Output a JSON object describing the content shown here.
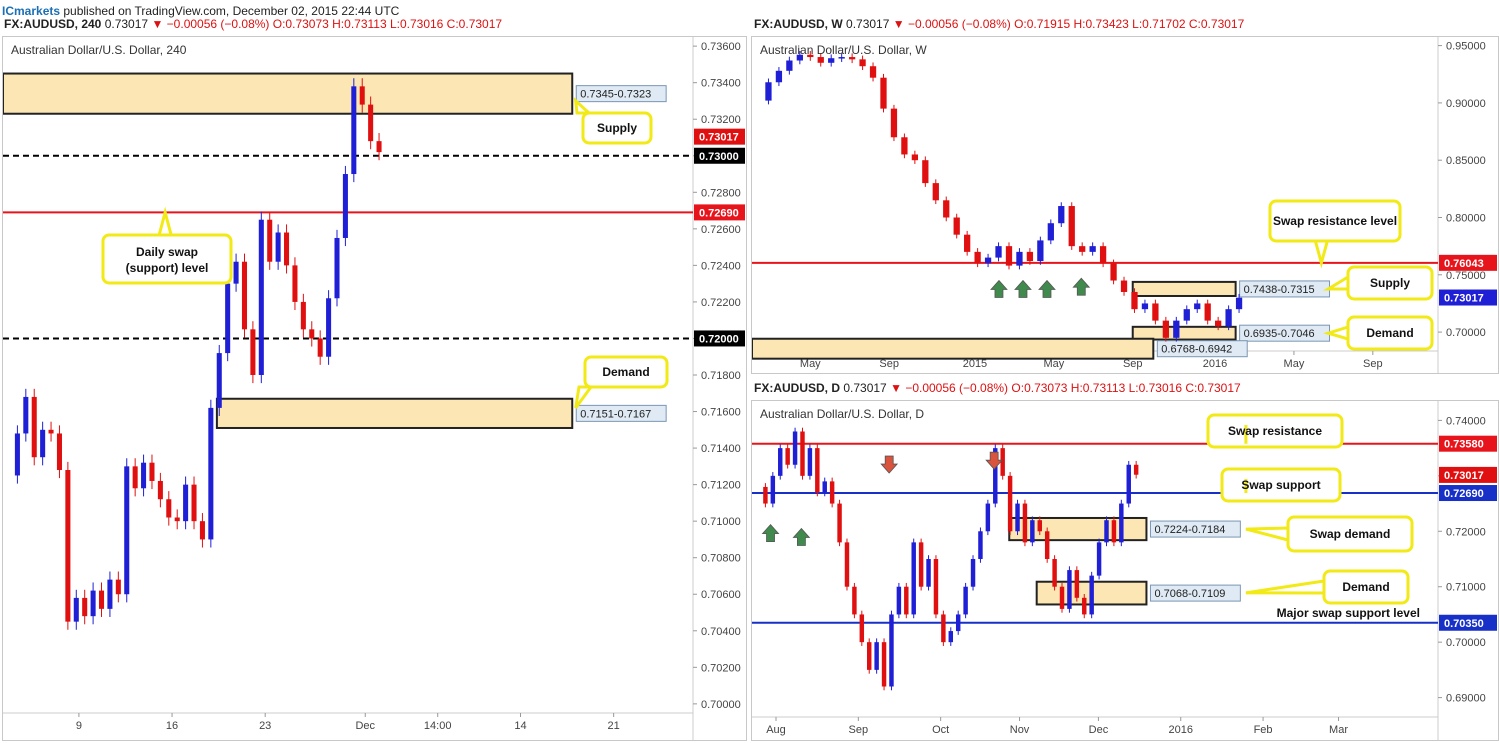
{
  "header": {
    "brand": "ICmarkets",
    "published": " published on TradingView.com, December 02, 2015 22:44 UTC"
  },
  "quote_4h": {
    "symbol": "FX:AUDUSD, 240",
    "price": "0.73017",
    "change": "−0.00056 (−0.08%)",
    "ohlc": "O:0.73073 H:0.73113 L:0.73016 C:0.73017"
  },
  "quote_w": {
    "symbol": "FX:AUDUSD, W",
    "price": "0.73017",
    "change": "−0.00056 (−0.08%)",
    "ohlc": "O:0.71915 H:0.73423 L:0.71702 C:0.73017"
  },
  "quote_d": {
    "symbol": "FX:AUDUSD, D",
    "price": "0.73017",
    "change": "−0.00056 (−0.08%)",
    "ohlc": "O:0.73073 H:0.73113 L:0.73016 C:0.73017"
  },
  "colors": {
    "up": "#1f1fd6",
    "down": "#e01010",
    "zone_fill": "#fce7b4",
    "callout_border": "#f2ea17",
    "arrow_green": "#3f8a4c",
    "arrow_red": "#d9533d",
    "hline_red": "#e8141c",
    "hline_blue": "#1730c7"
  },
  "chart_data": [
    {
      "id": "h4",
      "type": "candlestick",
      "title": "Australian Dollar/U.S. Dollar, 240",
      "ylim": [
        0.6995,
        0.7365
      ],
      "y_ticks": [
        "0.73600",
        "0.73400",
        "0.73200",
        "0.73000",
        "0.72800",
        "0.72600",
        "0.72400",
        "0.72200",
        "0.72000",
        "0.71800",
        "0.71600",
        "0.71400",
        "0.71200",
        "0.71000",
        "0.70800",
        "0.70600",
        "0.70400",
        "0.70200",
        "0.70000"
      ],
      "x_ticks": [
        "9",
        "16",
        "23",
        "Dec",
        "14:00",
        "14",
        "21"
      ],
      "x_tick_pos": [
        0.11,
        0.245,
        0.38,
        0.525,
        0.63,
        0.75,
        0.885
      ],
      "path": [
        0.7125,
        0.7148,
        0.7168,
        0.7135,
        0.715,
        0.7148,
        0.7128,
        0.7045,
        0.7058,
        0.7048,
        0.7062,
        0.7052,
        0.7068,
        0.706,
        0.713,
        0.7118,
        0.7132,
        0.7122,
        0.7112,
        0.7102,
        0.71,
        0.712,
        0.71,
        0.709,
        0.7162,
        0.7192,
        0.723,
        0.7242,
        0.7205,
        0.718,
        0.7265,
        0.7242,
        0.7258,
        0.724,
        0.722,
        0.7205,
        0.72,
        0.719,
        0.7222,
        0.7255,
        0.729,
        0.7338,
        0.7328,
        0.7308,
        0.7302
      ],
      "hlines": [
        {
          "value": 0.73,
          "label": "0.73000",
          "style": "dashed-black"
        },
        {
          "value": 0.7269,
          "label": "0.72690",
          "style": "solid-red"
        },
        {
          "value": 0.72,
          "label": "0.72000",
          "style": "dashed-black"
        }
      ],
      "price_label": {
        "value": 0.73017,
        "text": "0.73017"
      },
      "zones": [
        {
          "from": 0.7323,
          "to": 0.7345,
          "label": "0.7345-0.7323",
          "x_start": 0.0,
          "x_end": 0.825
        },
        {
          "from": 0.7151,
          "to": 0.7167,
          "label": "0.7151-0.7167",
          "x_start": 0.31,
          "x_end": 0.825
        }
      ],
      "callouts": [
        {
          "text": "Supply",
          "anchor": [
            0.83,
            0.733
          ]
        },
        {
          "text": "Daily swap (support) level",
          "anchor": [
            0.235,
            0.7269
          ]
        },
        {
          "text": "Demand",
          "anchor": [
            0.83,
            0.7162
          ]
        }
      ]
    },
    {
      "id": "w",
      "type": "candlestick",
      "title": "Australian Dollar/U.S. Dollar, W",
      "ylim": [
        0.6835,
        0.9575
      ],
      "y_ticks": [
        "0.95000",
        "0.90000",
        "0.85000",
        "0.80000",
        "0.75000",
        "0.70000"
      ],
      "x_ticks": [
        "May",
        "Sep",
        "2015",
        "May",
        "Sep",
        "2016",
        "May",
        "Sep"
      ],
      "x_tick_pos": [
        0.085,
        0.2,
        0.325,
        0.44,
        0.555,
        0.675,
        0.79,
        0.905
      ],
      "path": [
        0.902,
        0.918,
        0.928,
        0.937,
        0.942,
        0.94,
        0.935,
        0.939,
        0.94,
        0.938,
        0.932,
        0.922,
        0.895,
        0.87,
        0.855,
        0.85,
        0.83,
        0.815,
        0.8,
        0.785,
        0.77,
        0.76,
        0.765,
        0.775,
        0.758,
        0.77,
        0.762,
        0.78,
        0.795,
        0.81,
        0.775,
        0.77,
        0.775,
        0.76,
        0.745,
        0.735,
        0.72,
        0.725,
        0.71,
        0.695,
        0.71,
        0.72,
        0.725,
        0.71,
        0.705,
        0.72,
        0.73
      ],
      "hlines": [
        {
          "value": 0.76043,
          "label": "0.76043",
          "style": "solid-red"
        }
      ],
      "price_label": {
        "value": 0.73017,
        "text": "0.73017"
      },
      "zones": [
        {
          "from": 0.7315,
          "to": 0.7438,
          "label": "0.7438-0.7315",
          "x_start": 0.555,
          "x_end": 0.705
        },
        {
          "from": 0.7046,
          "to": 0.6935,
          "label": "0.6935-0.7046",
          "x_start": 0.555,
          "x_end": 0.705
        },
        {
          "from": 0.6768,
          "to": 0.6942,
          "label": "0.6768-0.6942",
          "x_start": 0.0,
          "x_end": 0.585
        }
      ],
      "arrows": [
        {
          "x": 0.36,
          "value": 0.745,
          "dir": "up",
          "color": "green"
        },
        {
          "x": 0.395,
          "value": 0.745,
          "dir": "up",
          "color": "green"
        },
        {
          "x": 0.43,
          "value": 0.745,
          "dir": "up",
          "color": "green"
        },
        {
          "x": 0.48,
          "value": 0.747,
          "dir": "up",
          "color": "green"
        }
      ],
      "callouts": [
        {
          "text": "Swap resistance level",
          "anchor": [
            0.83,
            0.7604
          ]
        },
        {
          "text": "Supply",
          "anchor": [
            0.84,
            0.7376
          ]
        },
        {
          "text": "Demand",
          "anchor": [
            0.84,
            0.699
          ]
        }
      ]
    },
    {
      "id": "d",
      "type": "candlestick",
      "title": "Australian Dollar/U.S. Dollar, D",
      "ylim": [
        0.6865,
        0.7435
      ],
      "y_ticks": [
        "0.74000",
        "0.73000",
        "0.72000",
        "0.71000",
        "0.70000",
        "0.69000"
      ],
      "x_ticks": [
        "Aug",
        "Sep",
        "Oct",
        "Nov",
        "Dec",
        "2016",
        "Feb",
        "Mar"
      ],
      "x_tick_pos": [
        0.035,
        0.155,
        0.275,
        0.39,
        0.505,
        0.625,
        0.745,
        0.855
      ],
      "path": [
        0.728,
        0.725,
        0.73,
        0.735,
        0.732,
        0.738,
        0.73,
        0.735,
        0.727,
        0.729,
        0.725,
        0.718,
        0.71,
        0.705,
        0.7,
        0.695,
        0.7,
        0.692,
        0.705,
        0.71,
        0.705,
        0.718,
        0.71,
        0.715,
        0.705,
        0.7,
        0.702,
        0.705,
        0.71,
        0.715,
        0.72,
        0.725,
        0.735,
        0.73,
        0.72,
        0.725,
        0.718,
        0.722,
        0.72,
        0.715,
        0.71,
        0.706,
        0.713,
        0.708,
        0.705,
        0.712,
        0.718,
        0.722,
        0.718,
        0.725,
        0.732,
        0.7302
      ],
      "hlines": [
        {
          "value": 0.7358,
          "label": "0.73580",
          "style": "solid-red"
        },
        {
          "value": 0.7269,
          "label": "0.72690",
          "style": "solid-blue"
        },
        {
          "value": 0.7035,
          "label": "0.70350",
          "style": "solid-blue"
        }
      ],
      "price_label": {
        "value": 0.73017,
        "text": "0.73017"
      },
      "zones": [
        {
          "from": 0.7184,
          "to": 0.7224,
          "label": "0.7224-0.7184",
          "x_start": 0.375,
          "x_end": 0.575
        },
        {
          "from": 0.7068,
          "to": 0.7109,
          "label": "0.7068-0.7109",
          "x_start": 0.415,
          "x_end": 0.575
        }
      ],
      "arrows": [
        {
          "x": 0.027,
          "value": 0.7212,
          "dir": "up",
          "color": "green"
        },
        {
          "x": 0.072,
          "value": 0.7205,
          "dir": "up",
          "color": "green"
        },
        {
          "x": 0.2,
          "value": 0.7305,
          "dir": "down",
          "color": "red"
        },
        {
          "x": 0.353,
          "value": 0.7312,
          "dir": "down",
          "color": "red"
        }
      ],
      "callouts": [
        {
          "text": "Swap resistance",
          "anchor": [
            0.72,
            0.7358
          ]
        },
        {
          "text": "Swap support",
          "anchor": [
            0.72,
            0.7269
          ]
        },
        {
          "text": "Swap demand",
          "anchor": [
            0.72,
            0.7204
          ]
        },
        {
          "text": "Demand",
          "anchor": [
            0.72,
            0.7089
          ]
        },
        {
          "text": "Major swap support level",
          "anchor": [
            0.0,
            0.0
          ]
        }
      ]
    }
  ]
}
